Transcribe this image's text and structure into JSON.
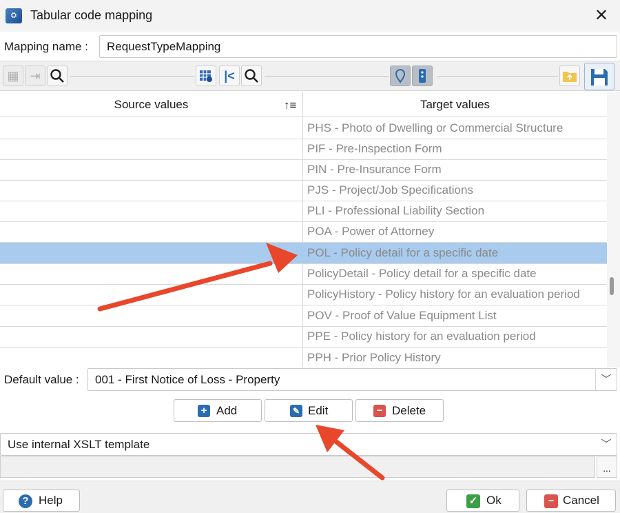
{
  "window": {
    "title": "Tabular code mapping",
    "close_symbol": "✕"
  },
  "mapping": {
    "label": "Mapping name :",
    "value": "RequestTypeMapping"
  },
  "grid": {
    "columns": {
      "source": "Source values",
      "target": "Target values"
    },
    "rows": [
      {
        "source": "",
        "target": "PHS - Photo of Dwelling or Commercial Structure",
        "selected": false
      },
      {
        "source": "",
        "target": "PIF - Pre-Inspection Form",
        "selected": false
      },
      {
        "source": "",
        "target": "PIN - Pre-Insurance Form",
        "selected": false
      },
      {
        "source": "",
        "target": "PJS - Project/Job Specifications",
        "selected": false
      },
      {
        "source": "",
        "target": "PLI - Professional Liability Section",
        "selected": false
      },
      {
        "source": "",
        "target": "POA - Power of Attorney",
        "selected": false
      },
      {
        "source": "",
        "target": "POL - Policy detail for a specific date",
        "selected": true
      },
      {
        "source": "",
        "target": "PolicyDetail - Policy detail for a specific date",
        "selected": false
      },
      {
        "source": "",
        "target": "PolicyHistory - Policy history for an evaluation period",
        "selected": false
      },
      {
        "source": "",
        "target": "POV - Proof of Value Equipment List",
        "selected": false
      },
      {
        "source": "",
        "target": "PPE - Policy history for an evaluation period",
        "selected": false
      },
      {
        "source": "",
        "target": "PPH - Prior Policy History",
        "selected": false
      }
    ]
  },
  "default_value": {
    "label": "Default value :",
    "value": "001 - First Notice of Loss - Property"
  },
  "actions": {
    "add": "Add",
    "edit": "Edit",
    "delete": "Delete"
  },
  "xslt": {
    "value": "Use internal XSLT template",
    "browse": "..."
  },
  "footer": {
    "help": "Help",
    "ok": "Ok",
    "cancel": "Cancel"
  },
  "colors": {
    "selection": "#a9cbee",
    "arrow": "#e8472b",
    "accent": "#2b6cb0"
  }
}
